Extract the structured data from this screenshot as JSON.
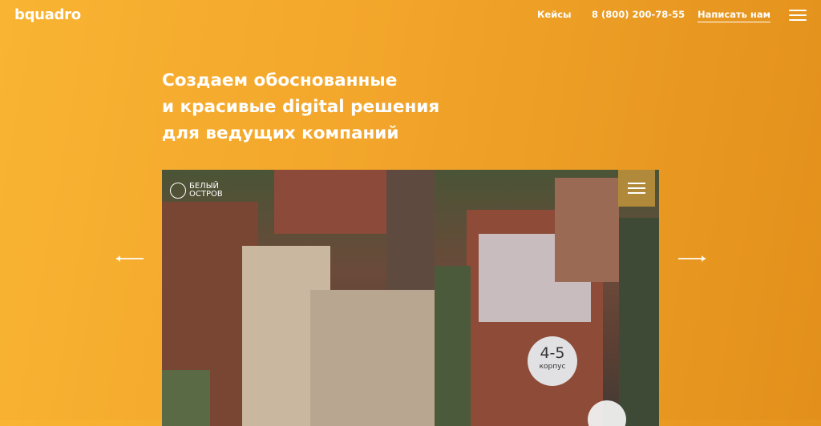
{
  "header": {
    "logo": "bquadro",
    "nav": {
      "cases": "Кейсы",
      "phone": "8 (800) 200-78-55",
      "write": "Написать нам"
    },
    "menu_icon": "hamburger-icon"
  },
  "hero": {
    "lines": [
      "Создаем обоснованные",
      "и красивые digital решения",
      "для ведущих компаний"
    ]
  },
  "slider": {
    "prev_icon": "arrow-left-icon",
    "next_icon": "arrow-right-icon",
    "slide": {
      "brand_line1": "БЕЛЫЙ",
      "brand_line2": "ОСТРОВ",
      "badge_number": "4-5",
      "badge_label": "корпус"
    }
  },
  "colors": {
    "background_start": "#f9b433",
    "background_end": "#e2901b",
    "text": "#ffffff"
  }
}
